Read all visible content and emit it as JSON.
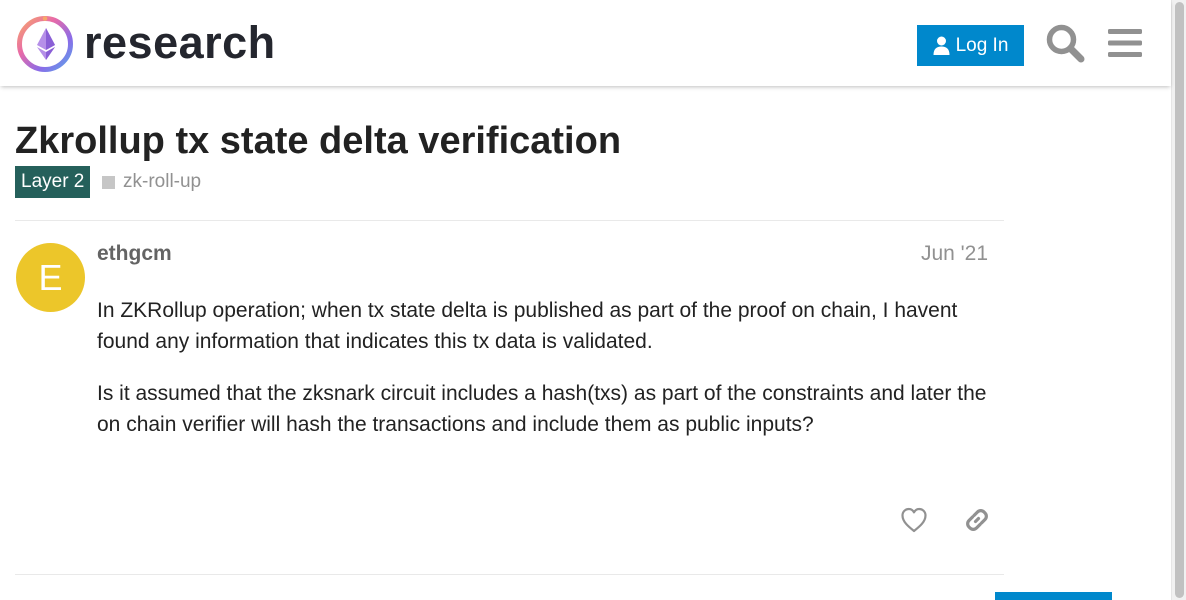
{
  "header": {
    "site_name": "research",
    "login_label": "Log In",
    "search_icon": "search-icon",
    "menu_icon": "hamburger-menu-icon",
    "accent_color": "#0088cc"
  },
  "topic": {
    "title": "Zkrollup tx state delta verification",
    "category": "Layer 2",
    "category_color": "#25605b",
    "tags": [
      "zk-roll-up"
    ]
  },
  "post": {
    "avatar_letter": "E",
    "avatar_color": "#ecc62a",
    "username": "ethgcm",
    "date": "Jun '21",
    "paragraphs": [
      "In ZKRollup operation; when tx state delta is published as part of the proof on chain, I havent found any information that indicates this tx data is validated.",
      "Is it assumed that the zksnark circuit includes a hash(txs) as part of the constraints and later the on chain verifier will hash the transactions and include them as public inputs?"
    ],
    "actions": {
      "like_icon": "heart-icon",
      "share_icon": "link-icon"
    }
  }
}
